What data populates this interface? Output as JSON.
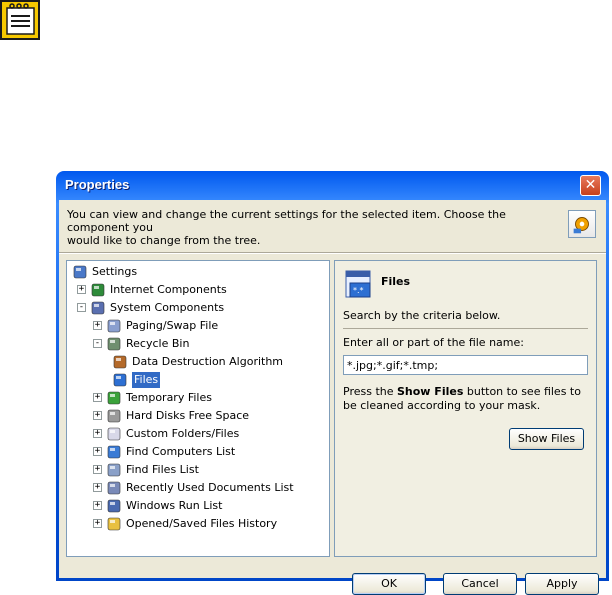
{
  "window": {
    "title": "Properties"
  },
  "description": {
    "line1": "You can view and change the current settings for the selected item. Choose the component you",
    "line2": "would like to change from the tree."
  },
  "tree": {
    "items": [
      {
        "label": "Settings",
        "icon": "computer-icon",
        "expander": ""
      },
      {
        "label": "Internet Components",
        "icon": "globe-icon",
        "expander": "+"
      },
      {
        "label": "System Components",
        "icon": "system-icon",
        "expander": "−"
      },
      {
        "label": "Paging/Swap File",
        "icon": "page-icon",
        "expander": "+"
      },
      {
        "label": "Recycle Bin",
        "icon": "recycle-bin-icon",
        "expander": "−"
      },
      {
        "label": "Data Destruction Algorithm",
        "icon": "algorithm-icon",
        "expander": ""
      },
      {
        "label": "Files",
        "icon": "files-icon",
        "expander": "",
        "selected": true
      },
      {
        "label": "Temporary Files",
        "icon": "temp-files-icon",
        "expander": "+"
      },
      {
        "label": "Hard Disks Free Space",
        "icon": "disk-icon",
        "expander": "+"
      },
      {
        "label": "Custom Folders/Files",
        "icon": "folder-icon",
        "expander": "+"
      },
      {
        "label": "Find Computers List",
        "icon": "find-computer-icon",
        "expander": "+"
      },
      {
        "label": "Find Files List",
        "icon": "find-files-icon",
        "expander": "+"
      },
      {
        "label": "Recently Used Documents List",
        "icon": "recent-docs-icon",
        "expander": "+"
      },
      {
        "label": "Windows Run List",
        "icon": "run-icon",
        "expander": "+"
      },
      {
        "label": "Opened/Saved Files History",
        "icon": "history-folder-icon",
        "expander": "+"
      }
    ]
  },
  "panel": {
    "title": "Files",
    "subtitle": "Search by the criteria below.",
    "mask_label": "Enter all or part of the file name:",
    "mask_value": "*.jpg;*.gif;*.tmp;",
    "hint_pre": "Press the ",
    "hint_bold": "Show Files",
    "hint_post": " button to see files to be cleaned according to your mask.",
    "show_files_label": "Show Files"
  },
  "buttons": {
    "ok": "OK",
    "cancel": "Cancel",
    "apply": "Apply"
  }
}
